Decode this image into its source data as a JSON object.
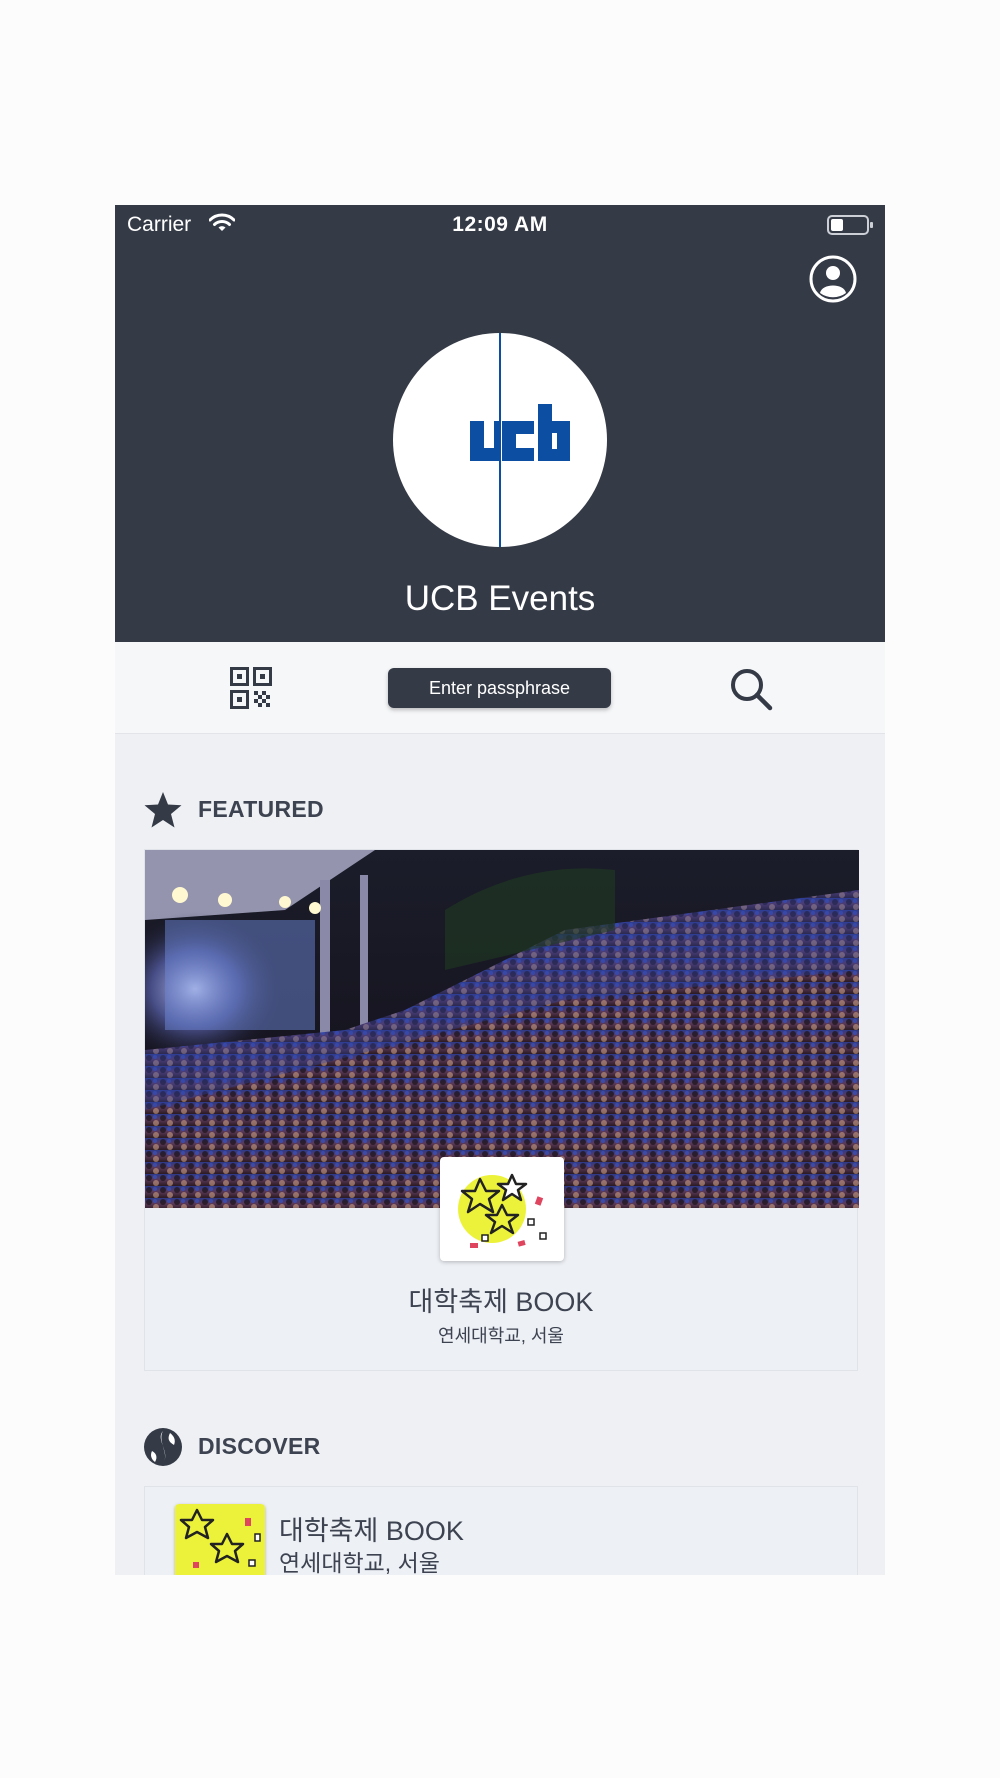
{
  "status_bar": {
    "carrier": "Carrier",
    "time": "12:09 AM"
  },
  "header": {
    "title": "UCB Events"
  },
  "toolbar": {
    "passphrase_label": "Enter passphrase"
  },
  "featured": {
    "section_title": "FEATURED",
    "event": {
      "title": "대학축제 BOOK",
      "location": "연세대학교, 서울"
    }
  },
  "discover": {
    "section_title": "DISCOVER",
    "items": [
      {
        "title": "대학축제 BOOK",
        "location": "연세대학교, 서울"
      }
    ]
  },
  "colors": {
    "header_bg": "#343a46",
    "logo_blue": "#0b4ea2",
    "content_bg": "#eef0f4"
  }
}
